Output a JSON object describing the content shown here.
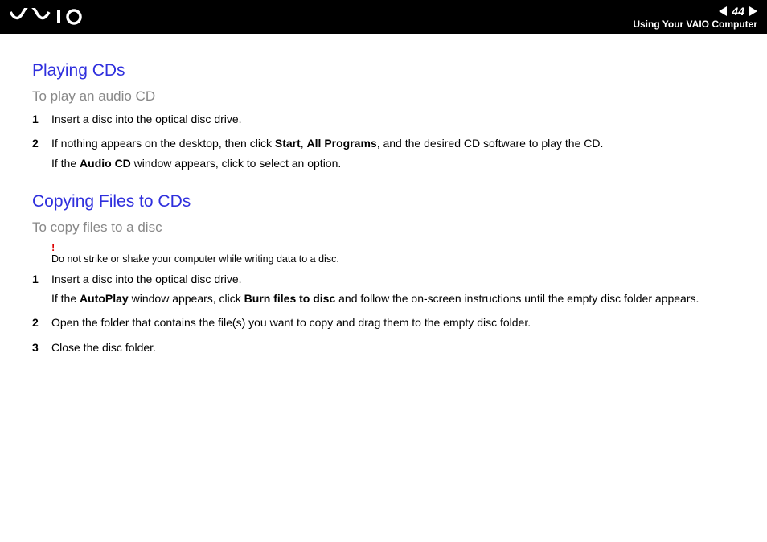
{
  "header": {
    "page_number": "44",
    "breadcrumb": "Using Your VAIO Computer"
  },
  "section1": {
    "title": "Playing CDs",
    "subtitle": "To play an audio CD",
    "steps": [
      {
        "num": "1",
        "line1": "Insert a disc into the optical disc drive."
      },
      {
        "num": "2",
        "prefix": "If nothing appears on the desktop, then click ",
        "b1": "Start",
        "mid1": ", ",
        "b2": "All Programs",
        "suffix1": ", and the desired CD software to play the CD.",
        "line2_prefix": "If the ",
        "line2_b": "Audio CD",
        "line2_suffix": " window appears, click to select an option."
      }
    ]
  },
  "section2": {
    "title": "Copying Files to CDs",
    "subtitle": "To copy files to a disc",
    "warning_mark": "!",
    "warning_text": "Do not strike or shake your computer while writing data to a disc.",
    "steps": [
      {
        "num": "1",
        "line1": "Insert a disc into the optical disc drive.",
        "line2_prefix": "If the ",
        "line2_b1": "AutoPlay",
        "line2_mid": " window appears, click ",
        "line2_b2": "Burn files to disc",
        "line2_suffix": " and follow the on-screen instructions until the empty disc folder appears."
      },
      {
        "num": "2",
        "line1": "Open the folder that contains the file(s) you want to copy and drag them to the empty disc folder."
      },
      {
        "num": "3",
        "line1": "Close the disc folder."
      }
    ]
  }
}
